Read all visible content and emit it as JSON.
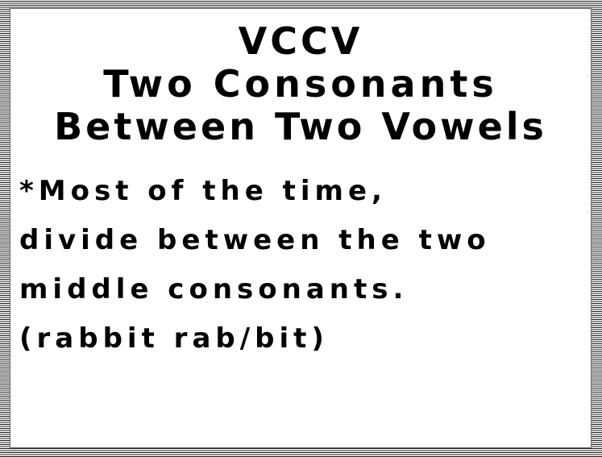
{
  "heading": {
    "line1": "VCCV",
    "line2": "Two Consonants",
    "line3": "Between Two Vowels"
  },
  "body": {
    "line1": "*Most of the time,",
    "line2": "divide between the two",
    "line3": "middle consonants.",
    "line4": "(rabbit rab/bit)"
  },
  "colors": {
    "text": "#000000",
    "background": "#ffffff",
    "border_hatch": "#1a1a1a"
  }
}
